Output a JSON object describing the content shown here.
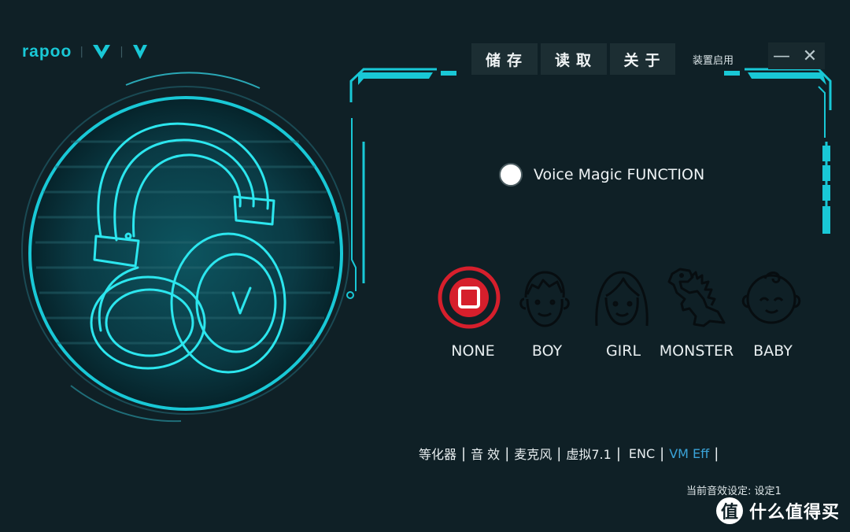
{
  "brand": {
    "logo_text": "rapoo"
  },
  "header": {
    "save_label": "储存",
    "load_label": "读取",
    "about_label": "关于",
    "device_label": "装置启用"
  },
  "window_controls": {
    "minimize": "—",
    "close": "✕"
  },
  "voice_magic": {
    "label": "Voice Magic FUNCTION",
    "enabled": false,
    "options": [
      {
        "label": "NONE",
        "selected": true
      },
      {
        "label": "BOY",
        "selected": false
      },
      {
        "label": "GIRL",
        "selected": false
      },
      {
        "label": "MONSTER",
        "selected": false
      },
      {
        "label": "BABY",
        "selected": false
      }
    ]
  },
  "tabs": [
    {
      "label": "等化器",
      "active": false
    },
    {
      "label": "音 效",
      "active": false
    },
    {
      "label": "麦克风",
      "active": false
    },
    {
      "label": "虚拟7.1",
      "active": false
    },
    {
      "label": "ENC",
      "active": false
    },
    {
      "label": "VM Eff",
      "active": true
    }
  ],
  "status": {
    "current_preset": "当前音效设定: 设定1"
  },
  "watermark": {
    "badge": "值",
    "text": "什么值得买"
  },
  "colors": {
    "background": "#0f2026",
    "accent_cyan": "#19c8d6",
    "selected_red": "#d61f2c",
    "active_tab": "#3aa3d8"
  }
}
